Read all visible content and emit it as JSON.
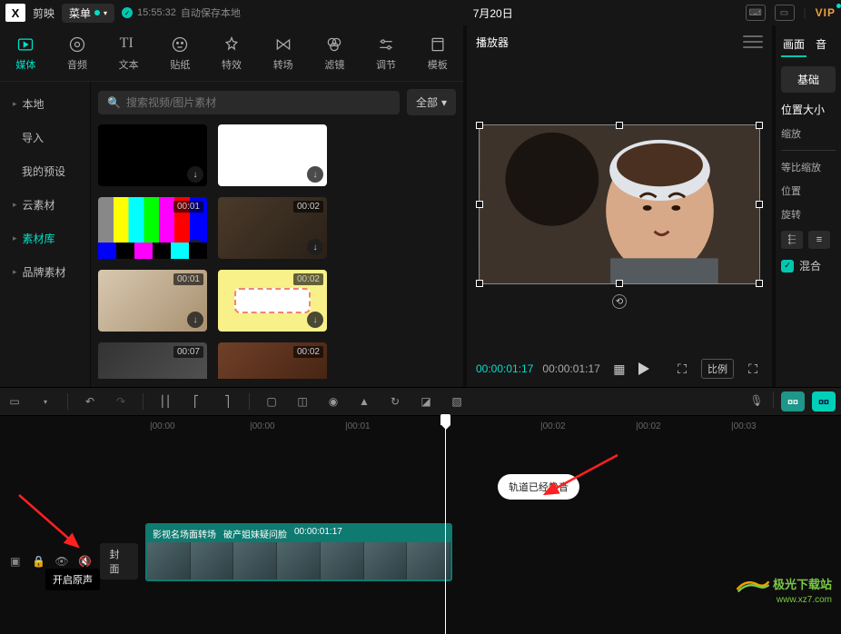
{
  "topbar": {
    "app_name": "剪映",
    "menu_label": "菜单",
    "autosave_time": "15:55:32",
    "autosave_text": "自动保存本地",
    "date_title": "7月20日",
    "vip_label": "VIP"
  },
  "tool_tabs": [
    {
      "label": "媒体",
      "icon": "media-icon",
      "active": true
    },
    {
      "label": "音频",
      "icon": "audio-icon"
    },
    {
      "label": "文本",
      "icon": "text-icon"
    },
    {
      "label": "贴纸",
      "icon": "sticker-icon"
    },
    {
      "label": "特效",
      "icon": "effect-icon"
    },
    {
      "label": "转场",
      "icon": "transition-icon"
    },
    {
      "label": "滤镜",
      "icon": "filter-icon"
    },
    {
      "label": "调节",
      "icon": "adjust-icon"
    },
    {
      "label": "模板",
      "icon": "template-icon"
    }
  ],
  "side_nav": {
    "local": "本地",
    "import": "导入",
    "my_presets": "我的预设",
    "cloud_assets": "云素材",
    "asset_lib": "素材库",
    "brand_assets": "品牌素材"
  },
  "asset_area": {
    "search_placeholder": "搜索视频/图片素材",
    "filter_label": "全部"
  },
  "thumbs": [
    {
      "time": ""
    },
    {
      "time": ""
    },
    {
      "time": "00:01"
    },
    {
      "time": "00:02"
    },
    {
      "time": "00:01"
    },
    {
      "time": "00:02"
    },
    {
      "time": "00:07"
    },
    {
      "time": "00:02"
    }
  ],
  "preview": {
    "title": "播放器",
    "current_tc": "00:00:01:17",
    "total_tc": "00:00:01:17",
    "ratio_label": "比例"
  },
  "props": {
    "tab_picture": "画面",
    "tab_audio": "音",
    "basic": "基础",
    "pos_size": "位置大小",
    "scale": "缩放",
    "aspect_scale": "等比缩放",
    "position": "位置",
    "rotation": "旋转",
    "blend": "混合"
  },
  "ruler_ticks": [
    "|00:00",
    "|00:00",
    "|00:01",
    "|00:02",
    "|00:02",
    "|00:03"
  ],
  "clip": {
    "title": "影视名场面转场",
    "subtitle": "破产姐妹疑问脸",
    "duration": "00:00:01:17"
  },
  "tooltip_mute": "轨道已经静音",
  "tooltip_enable_sound": "开启原声",
  "cover_label": "封面",
  "watermark": {
    "name": "极光下载站",
    "url": "www.xz7.com"
  }
}
